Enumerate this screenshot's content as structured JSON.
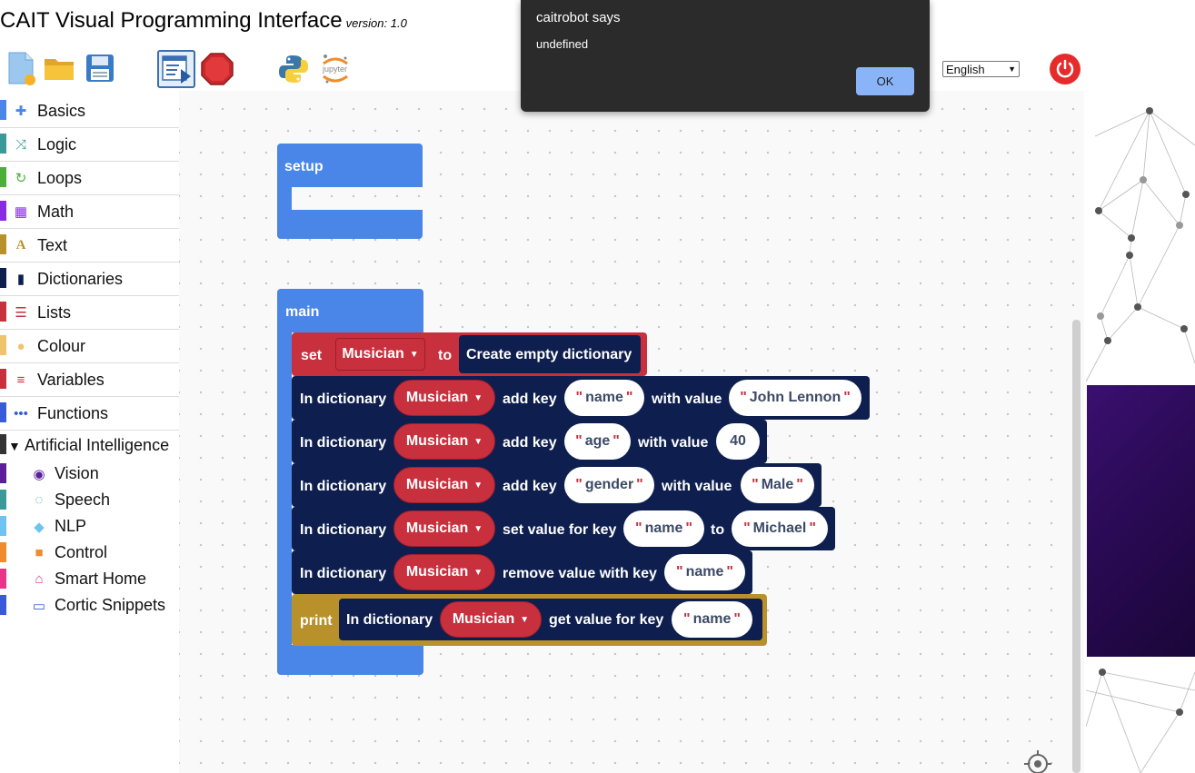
{
  "header": {
    "title": "CAIT Visual Programming Interface",
    "version": "version: 1.0",
    "language": "English"
  },
  "toolbar": {
    "icons": [
      "new-file-icon",
      "open-folder-icon",
      "save-icon",
      "run-icon",
      "stop-icon",
      "python-icon",
      "jupyter-icon",
      "power-icon"
    ],
    "jupyter_text": "jupyter"
  },
  "sidebar": {
    "categories": [
      {
        "label": "Basics",
        "color": "#4a86e8",
        "icon": "puzzle-icon"
      },
      {
        "label": "Logic",
        "color": "#3a9a9a",
        "icon": "shuffle-icon"
      },
      {
        "label": "Loops",
        "color": "#4caf3a",
        "icon": "loop-icon"
      },
      {
        "label": "Math",
        "color": "#8a2be2",
        "icon": "calculator-icon"
      },
      {
        "label": "Text",
        "color": "#b8912a",
        "icon": "text-icon"
      },
      {
        "label": "Dictionaries",
        "color": "#0e1f4f",
        "icon": "book-icon"
      },
      {
        "label": "Lists",
        "color": "#c9303e",
        "icon": "list-icon"
      },
      {
        "label": "Colour",
        "color": "#f0c36d",
        "icon": "palette-icon"
      },
      {
        "label": "Variables",
        "color": "#c9303e",
        "icon": "variables-icon"
      },
      {
        "label": "Functions",
        "color": "#3a5bd9",
        "icon": "dots-icon"
      }
    ],
    "ai_group": "Artificial Intelligence",
    "ai_items": [
      {
        "label": "Vision",
        "color": "#5b1f9c",
        "icon": "eye-icon"
      },
      {
        "label": "Speech",
        "color": "#3a9a9a",
        "icon": "ear-icon"
      },
      {
        "label": "NLP",
        "color": "#6fc3f0",
        "icon": "chat-icon"
      },
      {
        "label": "Control",
        "color": "#f08c2b",
        "icon": "robot-icon"
      },
      {
        "label": "Smart Home",
        "color": "#e8358a",
        "icon": "home-icon"
      },
      {
        "label": "Cortic Snippets",
        "color": "#3a5bd9",
        "icon": "laptop-icon"
      }
    ]
  },
  "blocks": {
    "setup": "setup",
    "main": "main",
    "set": "set",
    "to": "to",
    "variable": "Musician",
    "create_dict": "Create empty dictionary",
    "in_dict": "In dictionary",
    "add_key": "add key",
    "with_value": "with value",
    "set_value_for_key": "set value for key",
    "remove_value_with_key": "remove value with key",
    "get_value_for_key": "get value for key",
    "print": "print",
    "key_name": "name",
    "key_age": "age",
    "key_gender": "gender",
    "val_john": "John Lennon",
    "val_40": "40",
    "val_male": "Male",
    "val_michael": "Michael",
    "quote": "\""
  },
  "dialog": {
    "title": "caitrobot says",
    "message": "undefined",
    "ok": "OK"
  }
}
